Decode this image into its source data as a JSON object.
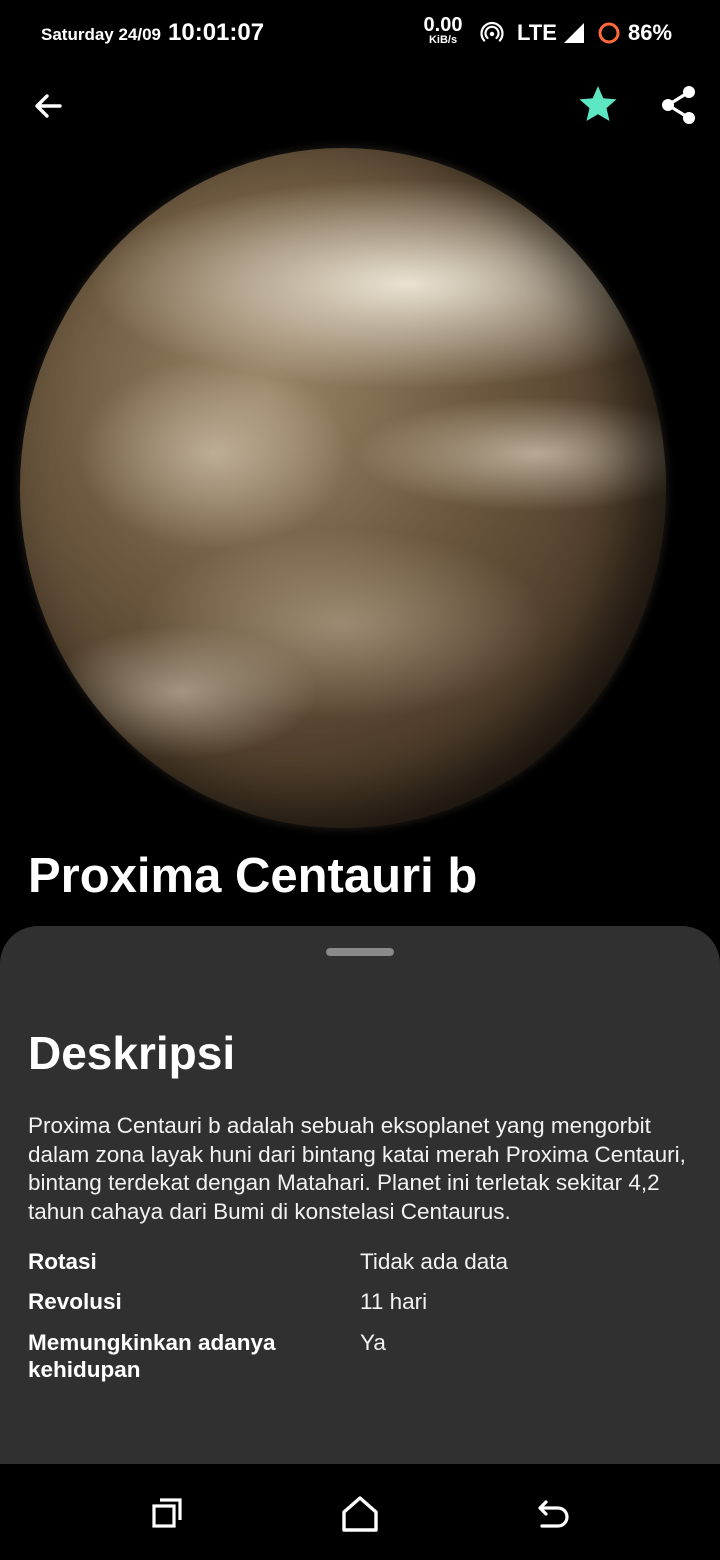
{
  "status_bar": {
    "date": "Saturday 24/09",
    "time": "10:01:07",
    "speed_value": "0.00",
    "speed_unit": "KiB/s",
    "network": "LTE",
    "battery": "86%"
  },
  "top_bar": {
    "back_icon": "arrow-left-icon",
    "favorite_icon": "star-icon",
    "share_icon": "share-icon",
    "accent_color": "#5de6c2"
  },
  "planet": {
    "name": "Proxima Centauri b"
  },
  "sheet": {
    "title": "Deskripsi",
    "description": "Proxima Centauri b adalah sebuah eksoplanet yang mengorbit dalam zona layak huni dari bintang katai merah Proxima Centauri, bintang terdekat dengan Matahari. Planet ini terletak sekitar 4,2 tahun cahaya dari Bumi di konstelasi Centaurus.",
    "properties": [
      {
        "label": "Rotasi",
        "value": "Tidak ada data"
      },
      {
        "label": "Revolusi",
        "value": "11 hari"
      },
      {
        "label": "Memungkinkan adanya kehidupan",
        "value": "Ya"
      }
    ]
  },
  "nav_bar": {
    "recents_icon": "recents-icon",
    "home_icon": "home-icon",
    "back_icon": "back-icon"
  }
}
